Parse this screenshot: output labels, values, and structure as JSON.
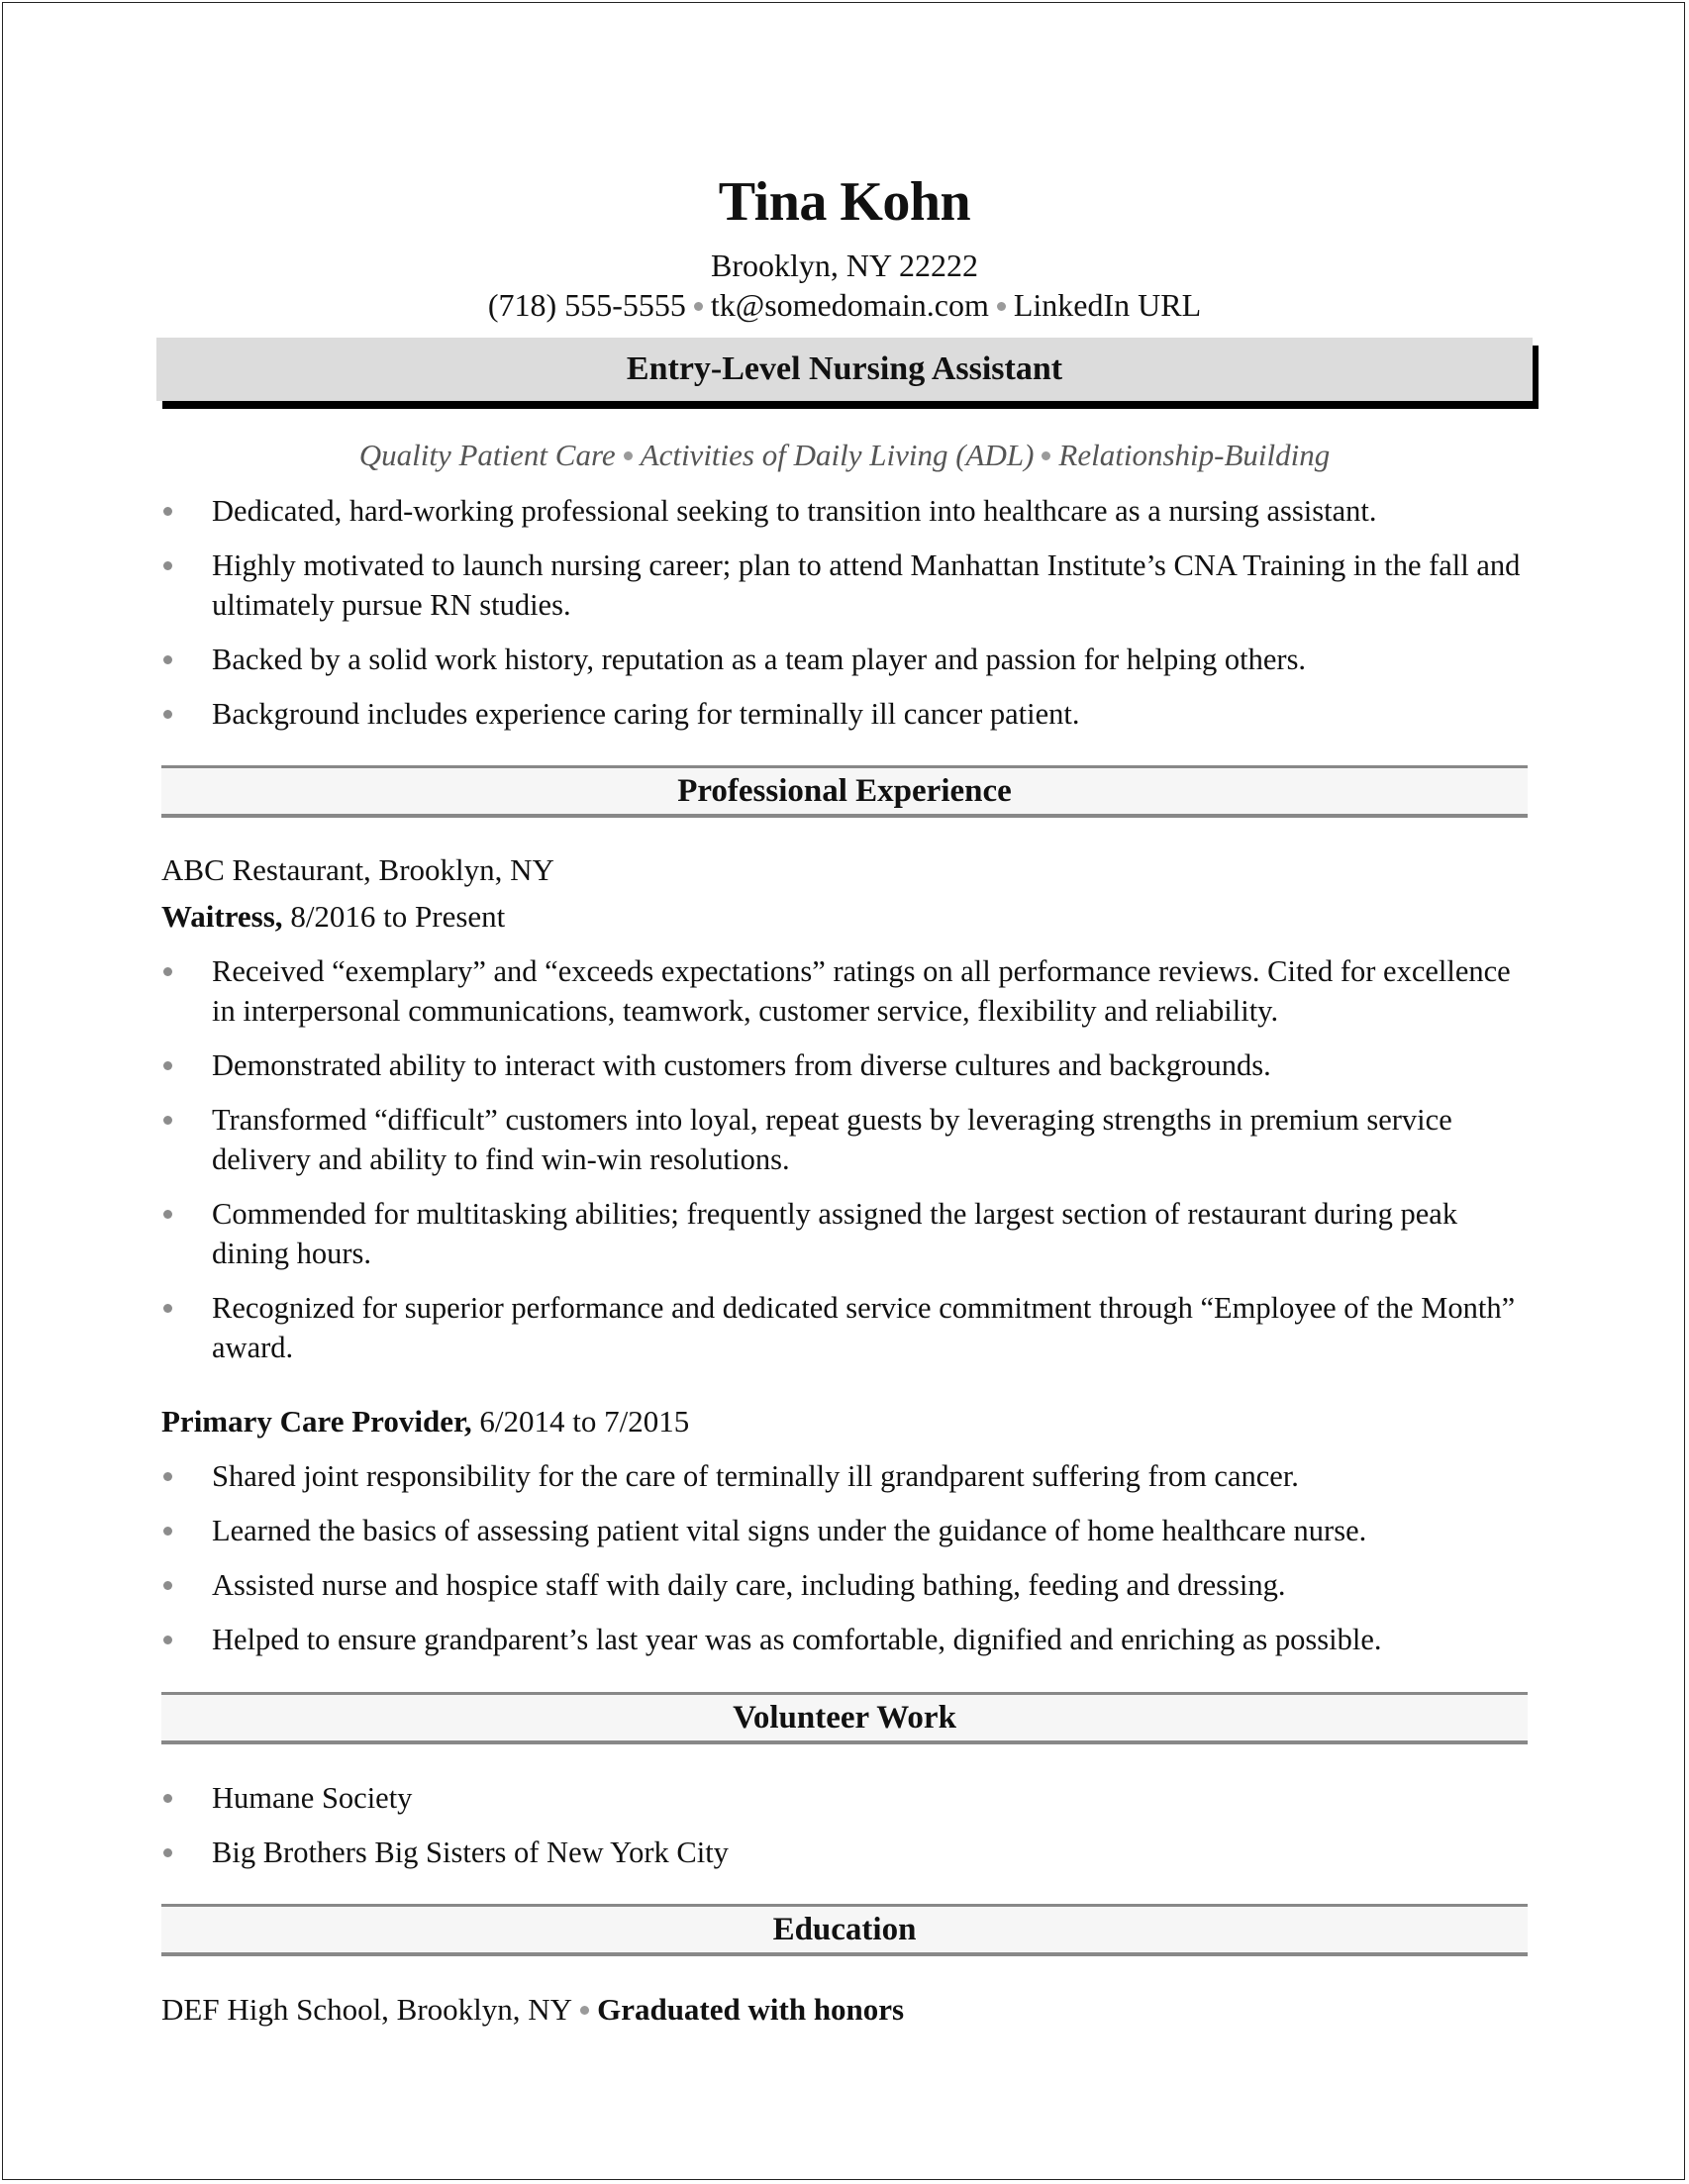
{
  "header": {
    "name": "Tina Kohn",
    "location": "Brooklyn, NY 22222",
    "phone": "(718) 555-5555",
    "email": "tk@somedomain.com",
    "linkedin": "LinkedIn URL"
  },
  "title_banner": "Entry-Level Nursing Assistant",
  "skills": [
    "Quality Patient Care",
    "Activities of Daily Living (ADL)",
    "Relationship-Building"
  ],
  "summary_bullets": [
    "Dedicated, hard-working professional seeking to transition into healthcare as a nursing assistant.",
    "Highly motivated to launch nursing career; plan to attend Manhattan Institute’s CNA Training in the fall and ultimately pursue RN studies.",
    "Backed by a solid work history, reputation as a team player and passion for helping others.",
    "Background includes experience caring for terminally ill cancer patient."
  ],
  "sections": {
    "experience": "Professional Experience",
    "volunteer": "Volunteer Work",
    "education": "Education"
  },
  "experience": [
    {
      "employer": "ABC Restaurant, Brooklyn, NY",
      "role": "Waitress,",
      "dates": " 8/2016 to Present",
      "bullets": [
        "Received “exemplary” and “exceeds expectations” ratings on all performance reviews. Cited for excellence in interpersonal communications, teamwork, customer service, flexibility and reliability.",
        "Demonstrated ability to interact with customers from diverse cultures and backgrounds.",
        "Transformed “difficult” customers into loyal, repeat guests by leveraging strengths in premium service delivery and ability to find win-win resolutions.",
        "Commended for multitasking abilities; frequently assigned the largest section of restaurant during peak dining hours.",
        "Recognized for superior performance and dedicated service commitment through “Employee of the Month” award."
      ]
    },
    {
      "role": "Primary Care Provider,",
      "dates": " 6/2014 to 7/2015",
      "bullets": [
        "Shared joint responsibility for the care of terminally ill grandparent suffering from cancer.",
        "Learned the basics of assessing patient vital signs under the guidance of home healthcare nurse.",
        "Assisted nurse and hospice staff with daily care, including bathing, feeding and dressing.",
        "Helped to ensure grandparent’s last year was as comfortable, dignified and enriching as possible."
      ]
    }
  ],
  "volunteer": [
    "Humane Society",
    "Big Brothers Big Sisters of New York City"
  ],
  "education": {
    "school": "DEF High School, Brooklyn, NY",
    "honor": "Graduated with honors"
  }
}
